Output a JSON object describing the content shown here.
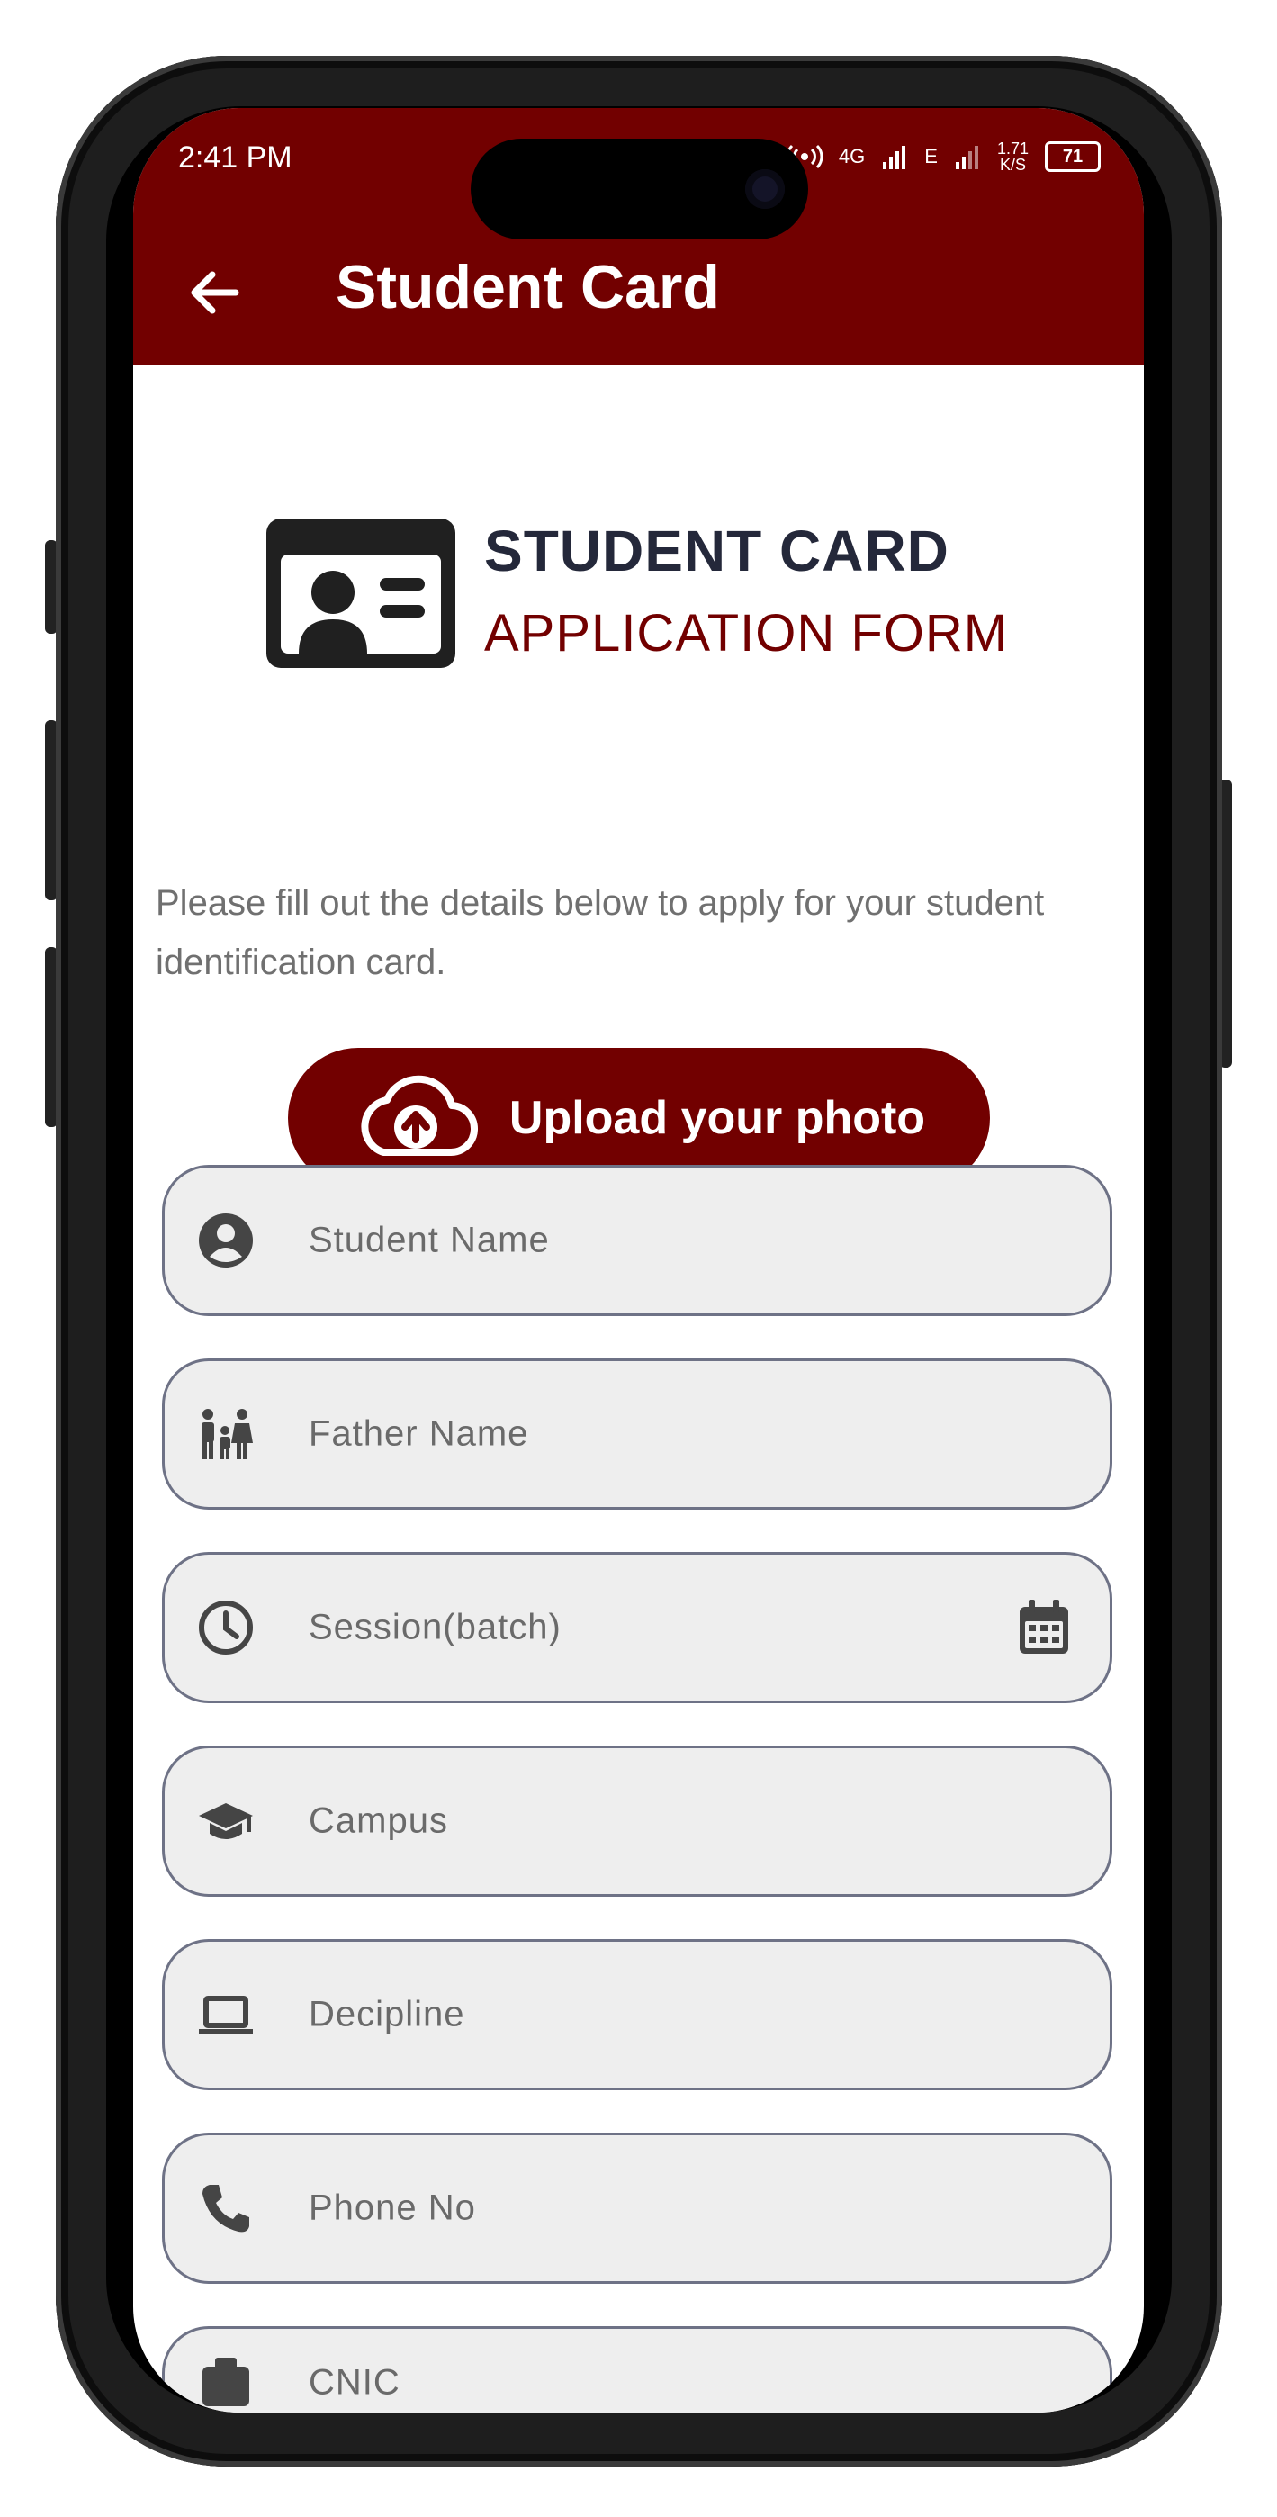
{
  "status_bar": {
    "time": "2:41 PM",
    "network_4g": "4G",
    "network_e": "E",
    "speed": "1.71",
    "speed_unit": "K/S",
    "battery": "71"
  },
  "app_bar": {
    "title": "Student Card",
    "background": "#720000",
    "back_icon": "arrow-left-icon"
  },
  "header": {
    "title": "STUDENT CARD",
    "subtitle": "APPLICATION FORM",
    "icon": "id-card-icon"
  },
  "intro_text": "Please fill out the details below to apply for your student identification card.",
  "upload_button": {
    "label": "Upload your photo",
    "icon": "cloud-upload-icon"
  },
  "form": {
    "fields": [
      {
        "placeholder": "Student Name",
        "icon": "person-icon"
      },
      {
        "placeholder": "Father Name",
        "icon": "family-icon"
      },
      {
        "placeholder": "Session(batch)",
        "icon": "clock-icon",
        "trailing_icon": "calendar-icon"
      },
      {
        "placeholder": "Campus",
        "icon": "graduation-cap-icon"
      },
      {
        "placeholder": "Decipline",
        "icon": "laptop-icon"
      },
      {
        "placeholder": "Phone No",
        "icon": "phone-icon"
      },
      {
        "placeholder": "CNIC",
        "icon": "id-badge-icon"
      }
    ]
  },
  "colors": {
    "accent": "#720000",
    "heading": "#24283a",
    "field_bg": "#eeeeee",
    "field_border": "#6e7286"
  }
}
